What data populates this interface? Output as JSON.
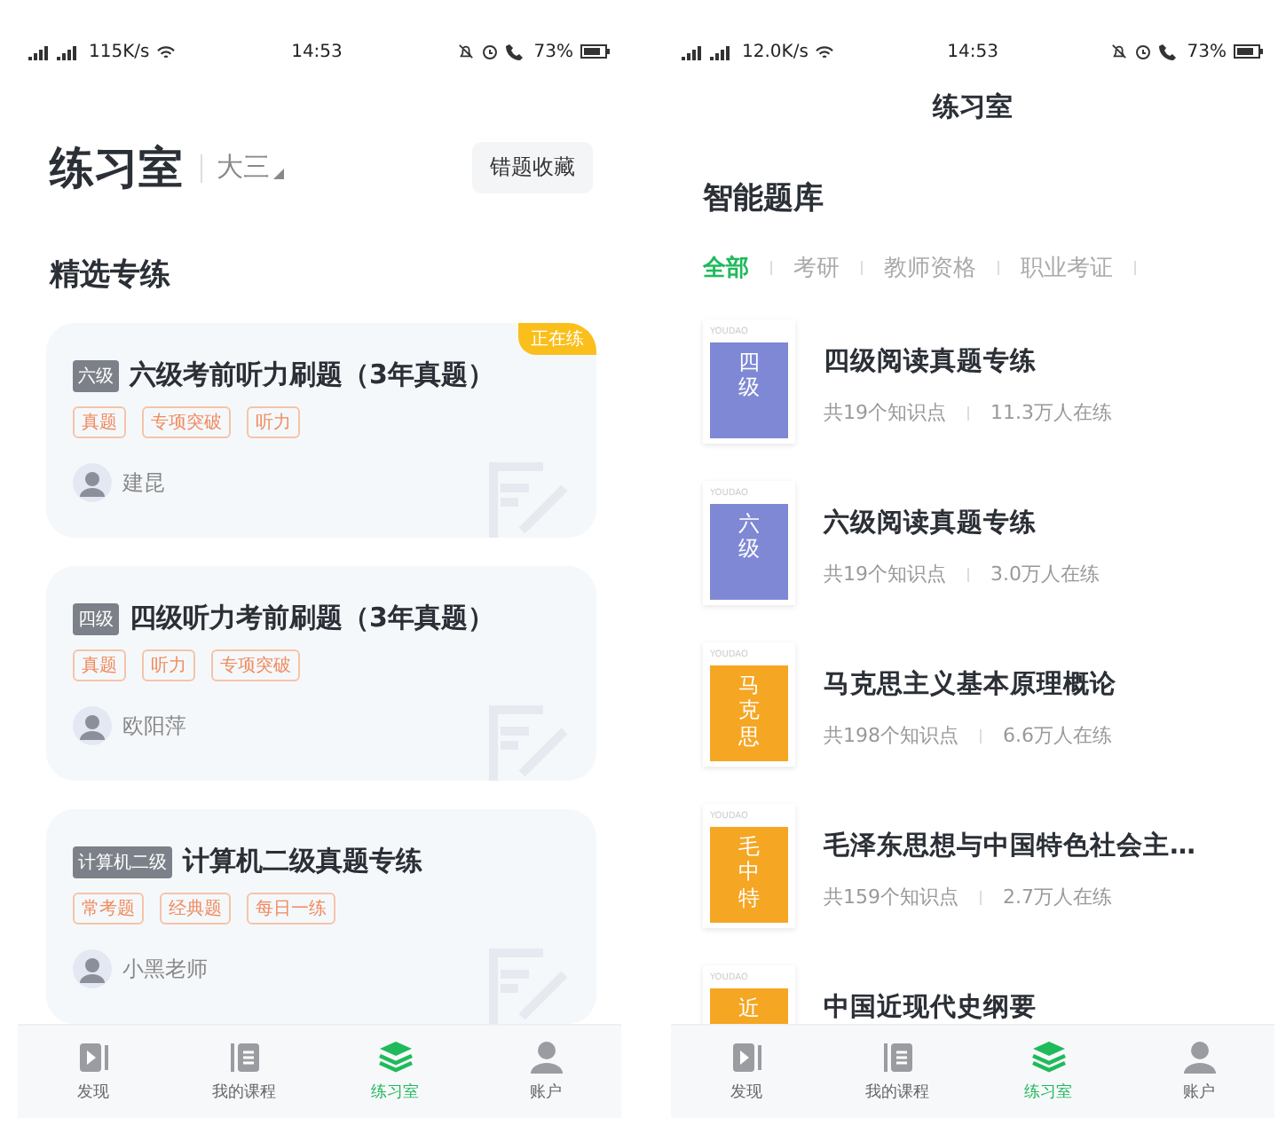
{
  "left_screen": {
    "status_bar": {
      "speed": "115K/s",
      "time": "14:53",
      "battery": "73%"
    },
    "header": {
      "title": "练习室",
      "grade": "大三",
      "button": "错题收藏"
    },
    "section_title": "精选专练",
    "cards": [
      {
        "level": "六级",
        "title": "六级考前听力刷题（3年真题）",
        "tags": [
          "真题",
          "专项突破",
          "听力"
        ],
        "teacher": "建昆",
        "ribbon": "正在练"
      },
      {
        "level": "四级",
        "title": "四级听力考前刷题（3年真题）",
        "tags": [
          "真题",
          "听力",
          "专项突破"
        ],
        "teacher": "欧阳萍"
      },
      {
        "level": "计算机二级",
        "title": "计算机二级真题专练",
        "tags": [
          "常考题",
          "经典题",
          "每日一练"
        ],
        "teacher": "小黑老师"
      }
    ],
    "tab_bar": [
      {
        "label": "发现",
        "selected": false
      },
      {
        "label": "我的课程",
        "selected": false
      },
      {
        "label": "练习室",
        "selected": true
      },
      {
        "label": "账户",
        "selected": false
      }
    ]
  },
  "right_screen": {
    "status_bar": {
      "speed": "12.0K/s",
      "time": "14:53",
      "battery": "73%"
    },
    "title": "练习室",
    "section_title": "智能题库",
    "filters": [
      {
        "label": "全部",
        "selected": true
      },
      {
        "label": "考研",
        "selected": false
      },
      {
        "label": "教师资格",
        "selected": false
      },
      {
        "label": "职业考证",
        "selected": false
      }
    ],
    "items": [
      {
        "cover": {
          "brand": "YOUDAO",
          "text": "四级",
          "color": "#7f88d4"
        },
        "title": "四级阅读真题专练",
        "points": "共19个知识点",
        "learners": "11.3万人在练"
      },
      {
        "cover": {
          "brand": "YOUDAO",
          "text": "六级",
          "color": "#7f88d4"
        },
        "title": "六级阅读真题专练",
        "points": "共19个知识点",
        "learners": "3.0万人在练"
      },
      {
        "cover": {
          "brand": "YOUDAO",
          "text": "马克思",
          "color": "#f5a623"
        },
        "title": "马克思主义基本原理概论",
        "points": "共198个知识点",
        "learners": "6.6万人在练"
      },
      {
        "cover": {
          "brand": "YOUDAO",
          "text": "毛中特",
          "color": "#f5a623"
        },
        "title": "毛泽东思想与中国特色社会主…",
        "points": "共159个知识点",
        "learners": "2.7万人在练"
      },
      {
        "cover": {
          "brand": "YOUDAO",
          "text": "近",
          "color": "#f5a623"
        },
        "title": "中国近现代史纲要"
      }
    ],
    "tab_bar": [
      {
        "label": "发现",
        "selected": false
      },
      {
        "label": "我的课程",
        "selected": false
      },
      {
        "label": "练习室",
        "selected": true
      },
      {
        "label": "账户",
        "selected": false
      }
    ]
  }
}
